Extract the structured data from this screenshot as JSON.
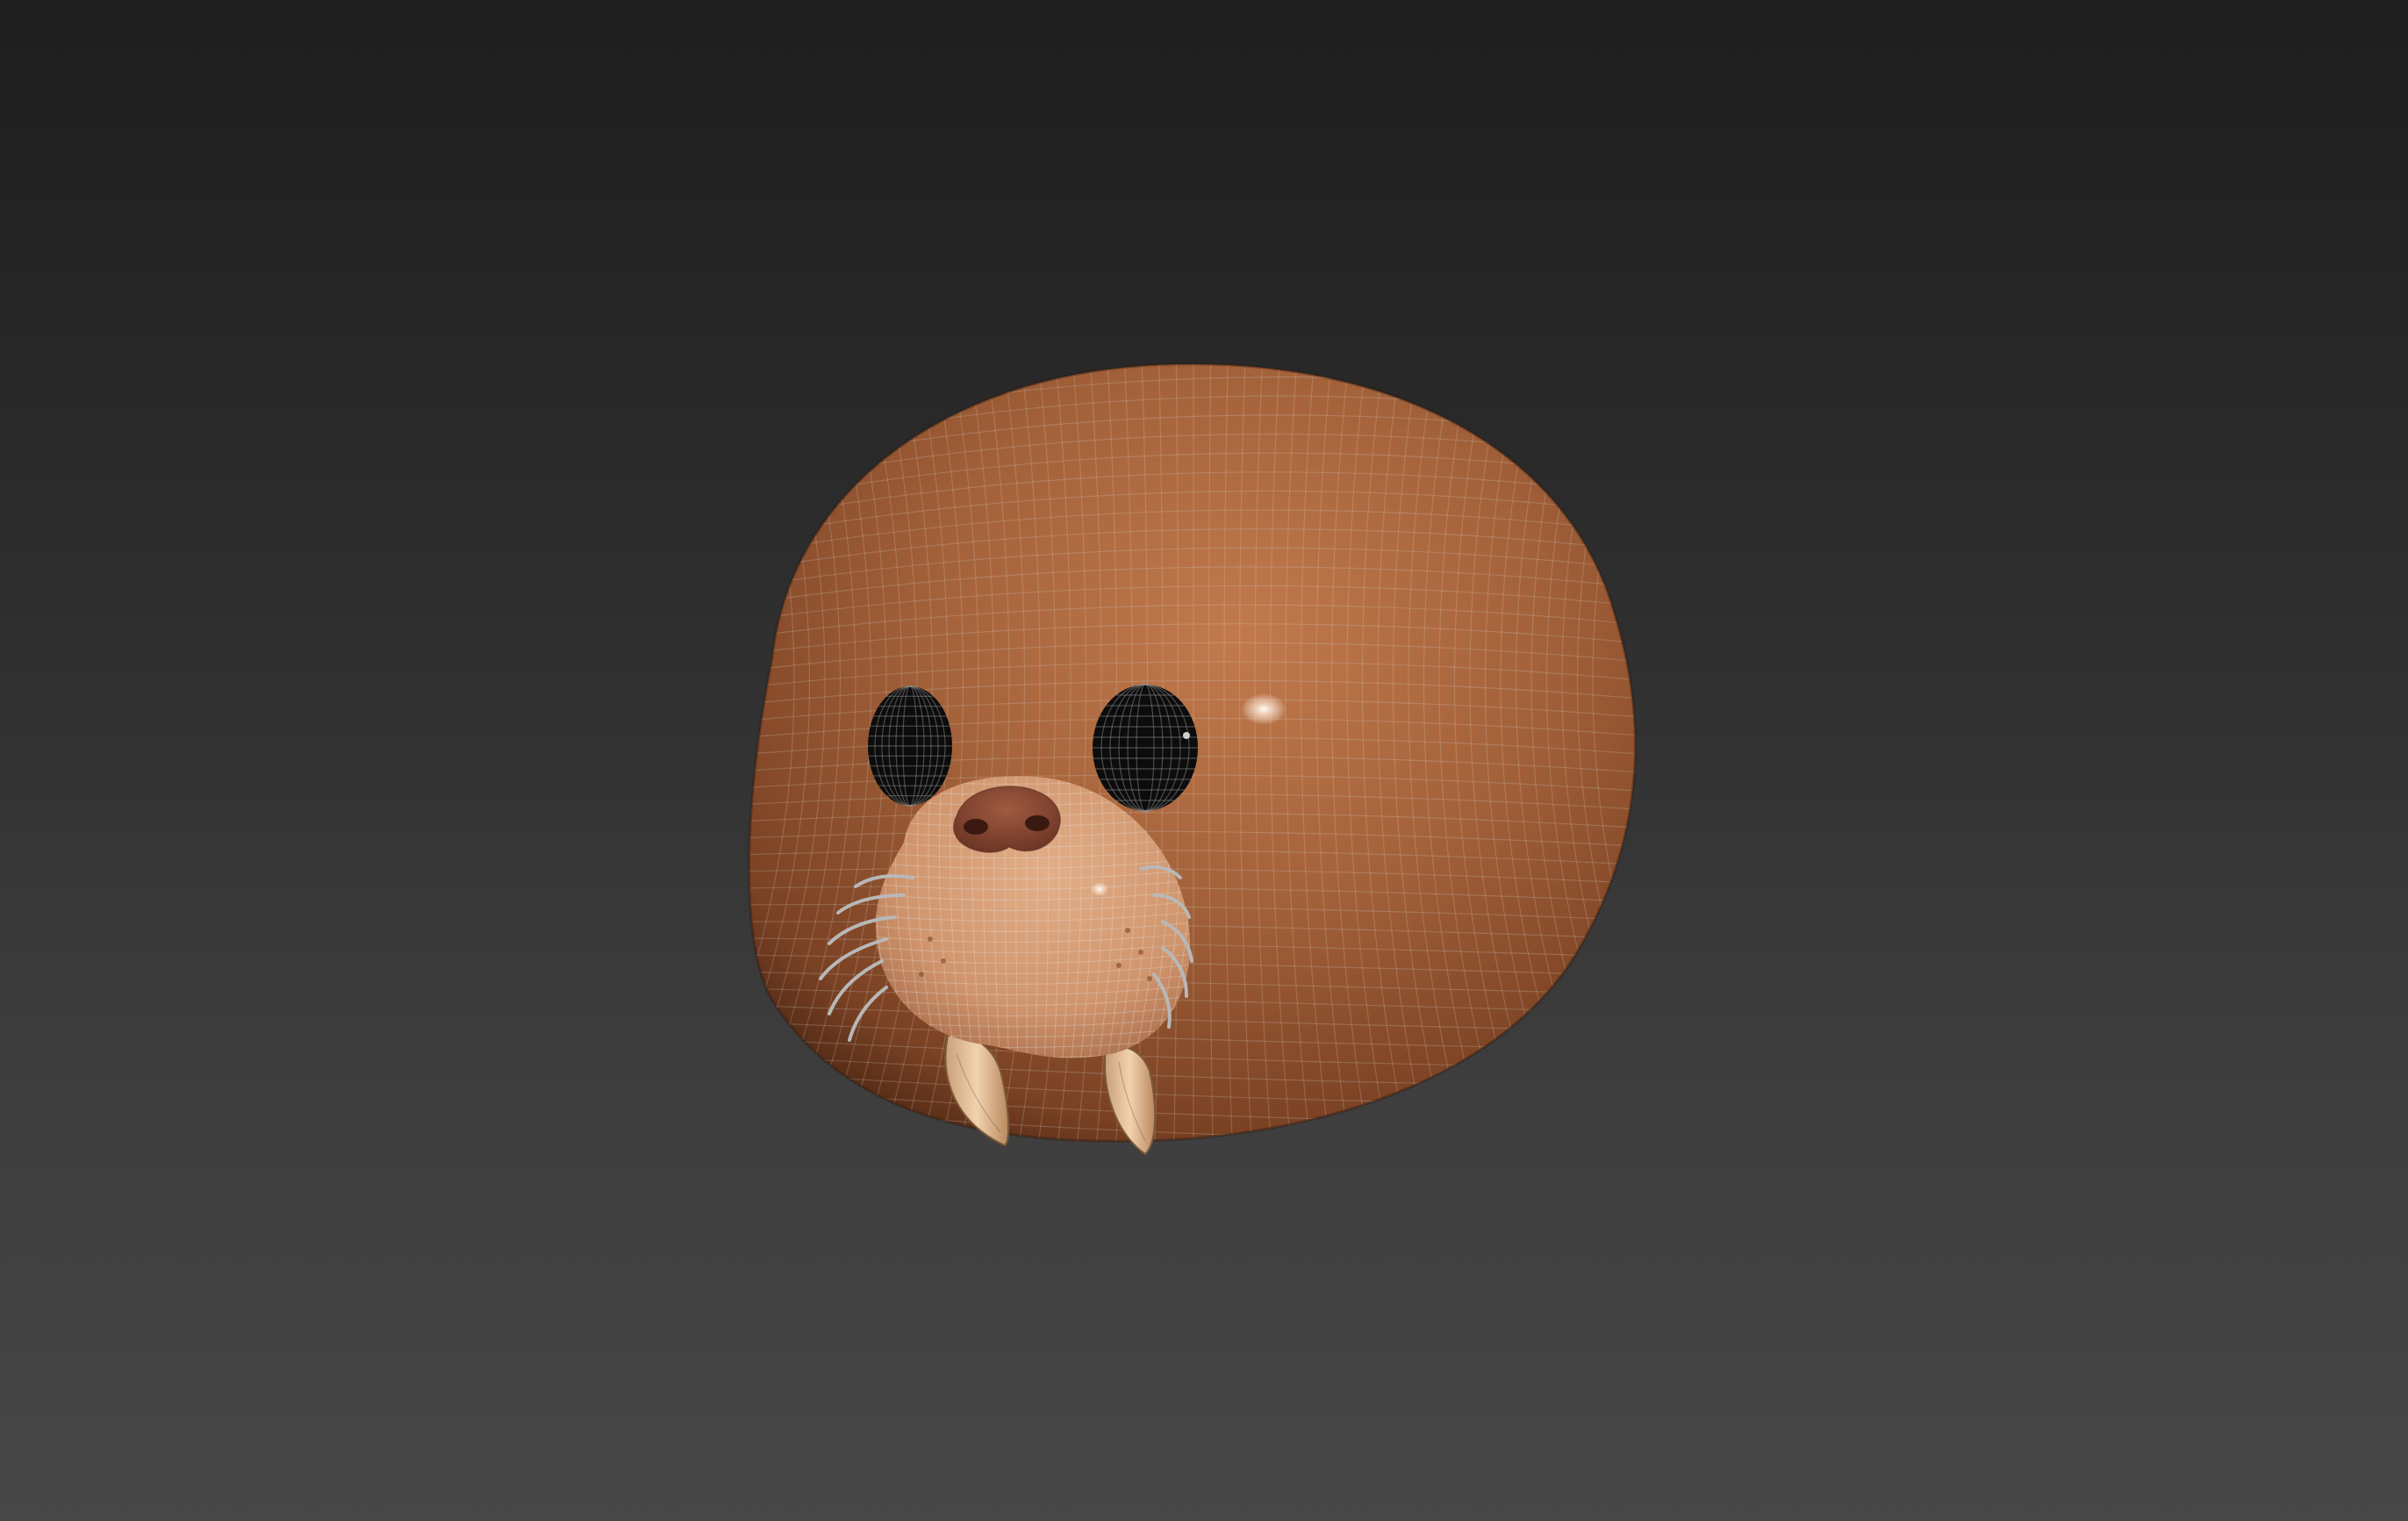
{
  "viewport": {
    "background_top": "#1e1e1e",
    "background_bottom": "#474747"
  },
  "model": {
    "subject": "walrus-head",
    "display_mode": "shaded-with-wireframe",
    "colors": {
      "body": "#a4623a",
      "body_highlight": "#c98458",
      "body_shadow": "#5a2f18",
      "muzzle": "#d49a72",
      "nose": "#8a4a34",
      "eyes": "#0c0c0c",
      "tusks": "#e8c29a",
      "whiskers": "#b8b8b8",
      "wire": "#c8c8c8"
    }
  }
}
